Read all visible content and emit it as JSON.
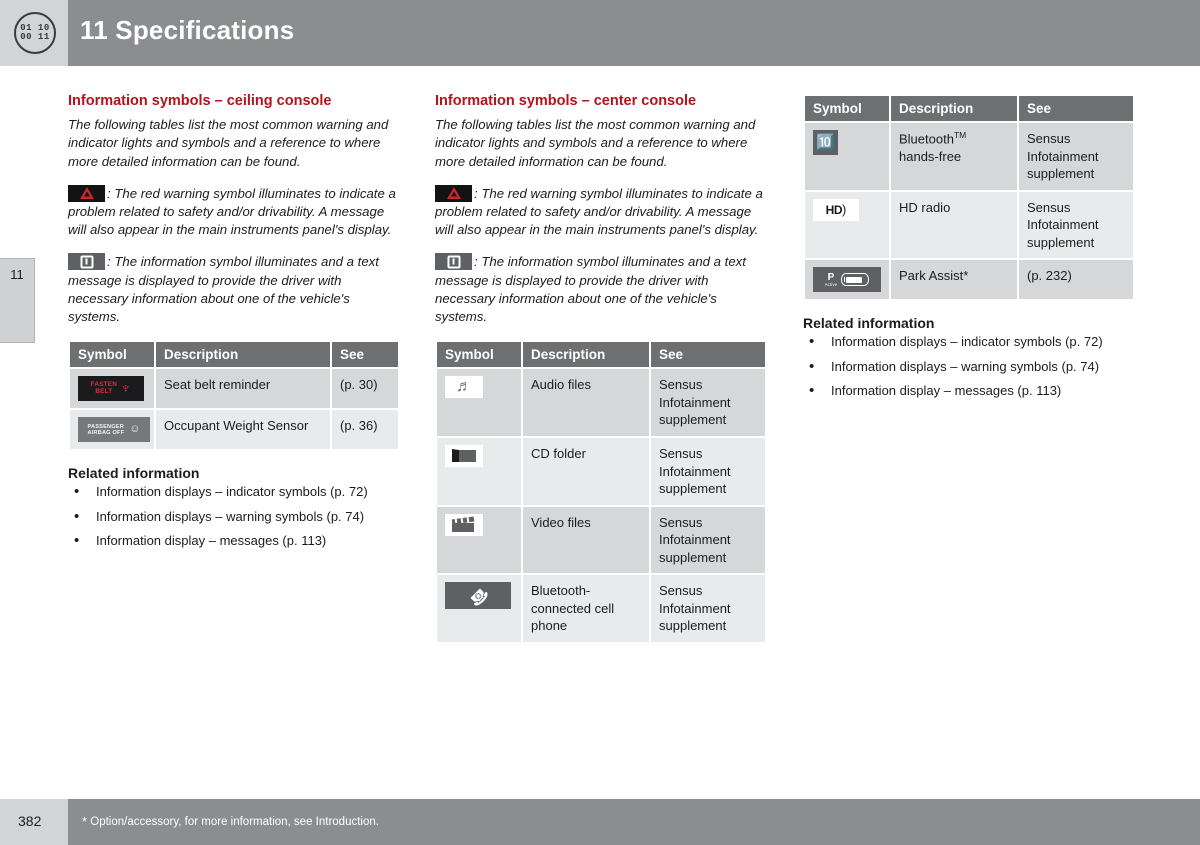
{
  "header": {
    "chapter_icon_line1": "01 10",
    "chapter_icon_line2": "00 11",
    "title": "11 Specifications"
  },
  "side_tab": {
    "chapter_number": "11"
  },
  "columns": {
    "left": {
      "section_title": "Information symbols – ceiling console",
      "intro": "The following tables list the most common warning and indicator lights and symbols and a reference to where more detailed information can be found.",
      "warning_paragraph": ": The red warning symbol illuminates to indicate a problem related to safety and/or drivability. A message will also appear in the main instruments panel's display.",
      "info_paragraph": ": The information symbol illuminates and a text message is displayed to provide the driver with necessary information about one of the vehicle's systems.",
      "table": {
        "headers": [
          "Symbol",
          "Description",
          "See"
        ],
        "rows": [
          {
            "symbol": "fasten-belt-symbol",
            "symbol_text_1": "FASTEN",
            "symbol_text_2": "BELT",
            "description": "Seat belt reminder",
            "see": "(p. 30)"
          },
          {
            "symbol": "passenger-airbag-off-symbol",
            "symbol_text_1": "PASSENGER",
            "symbol_text_2": "AIRBAG  OFF",
            "description": "Occupant Weight Sensor",
            "see": "(p. 36)"
          }
        ]
      },
      "related_title": "Related information",
      "related_items": [
        "Information displays – indicator symbols (p. 72)",
        "Information displays – warning symbols (p. 74)",
        "Information display – messages (p. 113)"
      ]
    },
    "center": {
      "section_title": "Information symbols – center console",
      "intro": "The following tables list the most common warning and indicator lights and symbols and a reference to where more detailed information can be found.",
      "warning_paragraph": ": The red warning symbol illuminates to indicate a problem related to safety and/or drivability. A message will also appear in the main instruments panel's display.",
      "info_paragraph": ": The information symbol illuminates and a text message is displayed to provide the driver with necessary information about one of the vehicle's systems.",
      "table": {
        "headers": [
          "Symbol",
          "Description",
          "See"
        ],
        "rows": [
          {
            "symbol": "audio-files-icon",
            "description": "Audio files",
            "see": "Sensus Infotainment supplement"
          },
          {
            "symbol": "cd-folder-icon",
            "description": "CD folder",
            "see": "Sensus Infotainment supplement"
          },
          {
            "symbol": "video-files-icon",
            "description": "Video files",
            "see": "Sensus Infotainment supplement"
          },
          {
            "symbol": "bluetooth-phone-icon",
            "description": "Bluetooth-connected cell phone",
            "see": "Sensus Infotainment supplement"
          }
        ]
      }
    },
    "right": {
      "table": {
        "headers": [
          "Symbol",
          "Description",
          "See"
        ],
        "rows": [
          {
            "symbol": "bluetooth-icon",
            "description_main": "Bluetooth",
            "description_tm": "TM",
            "description_rest": "hands-free",
            "see": "Sensus Infotainment supplement"
          },
          {
            "symbol": "hd-radio-icon",
            "description_main": "HD radio",
            "see": "Sensus Infotainment supplement"
          },
          {
            "symbol": "park-assist-icon",
            "description_main": "Park Assist*",
            "see": "(p. 232)"
          }
        ]
      },
      "related_title": "Related information",
      "related_items": [
        "Information displays – indicator symbols (p. 72)",
        "Information displays – warning symbols (p. 74)",
        "Information display – messages (p. 113)"
      ]
    }
  },
  "icon_labels": {
    "hd_text": "HD",
    "park_p": "P",
    "park_active": "Active"
  },
  "footer": {
    "page_number": "382",
    "star": "*",
    "note": "Option/accessory, for more information, see Introduction."
  },
  "colors": {
    "header_gray": "#8b8d8f",
    "accent_red": "#b5121b",
    "table_header": "#6d6f71",
    "row_dark": "#d6d7d9",
    "row_light": "#e9eaeb"
  }
}
